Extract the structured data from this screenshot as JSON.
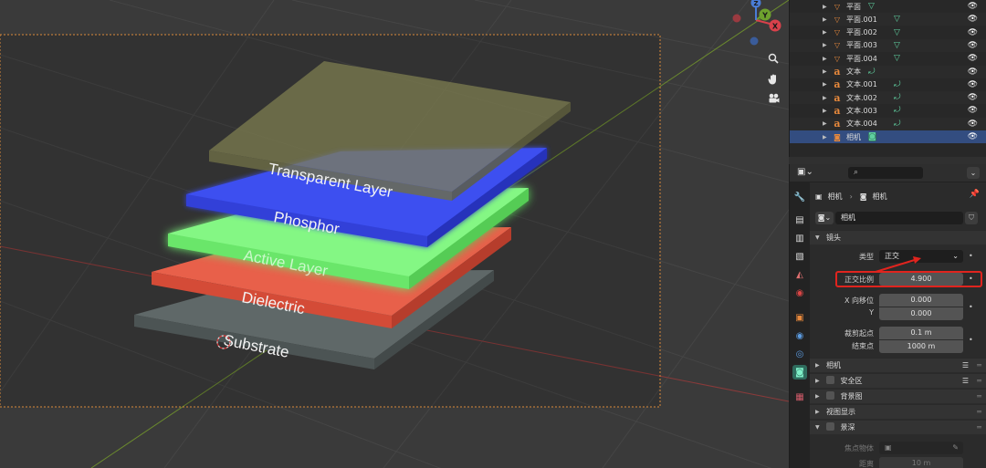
{
  "viewport": {
    "layers": [
      {
        "label": "Transparent Layer",
        "color": "#7a7a50"
      },
      {
        "label": "Phosphor",
        "color": "#3d4ff0"
      },
      {
        "label": "Active Layer",
        "color": "#7ef77e"
      },
      {
        "label": "Dielectric",
        "color": "#e8604a"
      },
      {
        "label": "Substrate",
        "color": "#5f6868"
      }
    ],
    "gizmo": {
      "z": "Z",
      "y": "Y",
      "x": "X"
    },
    "nav_icons": [
      "zoom-icon",
      "hand-icon",
      "camera-icon"
    ]
  },
  "outliner": {
    "items": [
      {
        "label": "平面",
        "icon": "mesh-icon",
        "kind": "mesh"
      },
      {
        "label": "平面.001",
        "icon": "mesh-icon",
        "kind": "mesh"
      },
      {
        "label": "平面.002",
        "icon": "mesh-icon",
        "kind": "mesh"
      },
      {
        "label": "平面.003",
        "icon": "mesh-icon",
        "kind": "mesh"
      },
      {
        "label": "平面.004",
        "icon": "mesh-icon",
        "kind": "mesh"
      },
      {
        "label": "文本",
        "icon": "text-icon",
        "kind": "text"
      },
      {
        "label": "文本.001",
        "icon": "text-icon",
        "kind": "text"
      },
      {
        "label": "文本.002",
        "icon": "text-icon",
        "kind": "text"
      },
      {
        "label": "文本.003",
        "icon": "text-icon",
        "kind": "text"
      },
      {
        "label": "文本.004",
        "icon": "text-icon",
        "kind": "text"
      },
      {
        "label": "相机",
        "icon": "camera-icon",
        "kind": "camera",
        "selected": true
      }
    ]
  },
  "properties": {
    "search_placeholder": "",
    "context_object": "相机",
    "context_data": "相机",
    "data_name": "相机",
    "lens_panel": "镜头",
    "type_label": "类型",
    "type_value": "正交",
    "ortho_scale_label": "正交比例",
    "ortho_scale_value": "4.900",
    "shift_x_label": "X 向移位",
    "shift_x_value": "0.000",
    "shift_y_label": "Y",
    "shift_y_value": "0.000",
    "clip_start_label": "裁剪起点",
    "clip_start_value": "0.1 m",
    "clip_end_label": "结束点",
    "clip_end_value": "1000 m",
    "panels": {
      "camera": "相机",
      "safe_areas": "安全区",
      "background_images": "背景图",
      "viewport_display": "视图显示",
      "depth_of_field": "景深"
    },
    "focus_object_label": "焦点物体",
    "distance_label": "距离",
    "distance_value": "10 m",
    "accent_color": "#e0241e",
    "selection_color": "#334d80"
  }
}
